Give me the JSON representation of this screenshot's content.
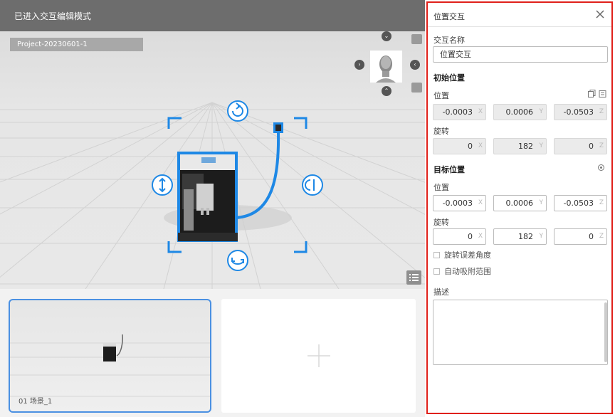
{
  "header": {
    "title": "已进入交互编辑模式"
  },
  "viewport": {
    "project_label": "Project-20230601-1",
    "nav": {
      "up": "⌃",
      "down": "⌄",
      "left": "‹",
      "right": "›"
    }
  },
  "scenes": [
    {
      "label": "01  场景_1",
      "selected": true
    }
  ],
  "panel": {
    "title": "位置交互",
    "name_label": "交互名称",
    "name_value": "位置交互",
    "initial": {
      "heading": "初始位置",
      "position_label": "位置",
      "position": {
        "x": "-0.0003",
        "y": "0.0006",
        "z": "-0.0503"
      },
      "rotation_label": "旋转",
      "rotation": {
        "x": "0",
        "y": "182",
        "z": "0"
      }
    },
    "target": {
      "heading": "目标位置",
      "position_label": "位置",
      "position": {
        "x": "-0.0003",
        "y": "0.0006",
        "z": "-0.0503"
      },
      "rotation_label": "旋转",
      "rotation": {
        "x": "0",
        "y": "182",
        "z": "0"
      }
    },
    "axes": {
      "x": "X",
      "y": "Y",
      "z": "Z"
    },
    "options": {
      "rotation_tolerance": "旋转误差角度",
      "auto_snap": "自动吸附范围"
    },
    "description_label": "描述",
    "description_value": ""
  },
  "colors": {
    "accent": "#4a90e2",
    "highlight_border": "#e0201a",
    "gizmo": "#1e88e5"
  }
}
